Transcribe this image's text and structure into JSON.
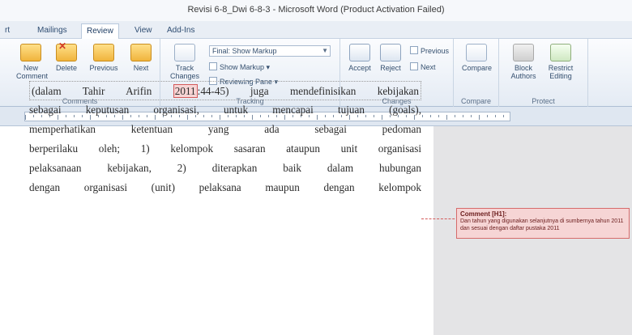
{
  "window": {
    "title": "Revisi 6-8_Dwi 6-8-3 - Microsoft Word (Product Activation Failed)"
  },
  "tabs": [
    {
      "label": "rt",
      "active": false
    },
    {
      "label": "Mailings",
      "active": false
    },
    {
      "label": "Review",
      "active": true
    },
    {
      "label": "View",
      "active": false
    },
    {
      "label": "Add-Ins",
      "active": false
    }
  ],
  "ribbon": {
    "comments": {
      "label": "Comments",
      "new_comment": "New Comment",
      "delete": "Delete",
      "previous": "Previous",
      "next": "Next"
    },
    "tracking": {
      "label": "Tracking",
      "track_changes": "Track Changes",
      "display_dropdown": "Final: Show Markup",
      "show_markup": "Show Markup",
      "reviewing_pane": "Reviewing Pane"
    },
    "changes": {
      "label": "Changes",
      "accept": "Accept",
      "reject": "Reject",
      "previous": "Previous",
      "next": "Next"
    },
    "compare": {
      "label": "Compare",
      "compare": "Compare"
    },
    "protect": {
      "label": "Protect",
      "block_authors": "Block Authors",
      "restrict_editing": "Restrict Editing"
    }
  },
  "document": {
    "lines": [
      {
        "pre": "(dalam Tahir Arifin ",
        "highlight": "2011",
        "post": ":44-45) juga mendefinisikan kebijakan"
      },
      {
        "text": "sebagai keputusan organisasi, untuk mencapai tujuan (goals),"
      },
      {
        "text": "memperhatikan ketentuan yang ada sebagai pedoman"
      },
      {
        "text": "berperilaku oleh; 1) kelompok sasaran ataupun unit organisasi"
      },
      {
        "text": "pelaksanaan kebijakan, 2) diterapkan baik dalam hubungan"
      },
      {
        "text": "dengan organisasi (unit) pelaksana maupun dengan kelompok"
      }
    ]
  },
  "comment": {
    "title": "Comment [H1]:",
    "text": "Dan tahun yang digunakan selanjutnya di sumbernya tahun 2011 dan sesuai dengan daftar pustaka 2011"
  }
}
